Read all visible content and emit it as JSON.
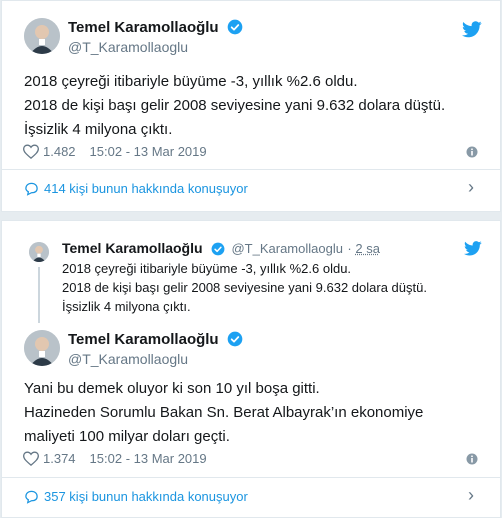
{
  "tweet1": {
    "name": "Temel Karamollaoğlu",
    "handle": "@T_Karamollaoglu",
    "lines": [
      "2018 çeyreği itibariyle büyüme -3, yıllık %2.6 oldu.",
      "2018 de kişi başı gelir 2008 seviyesine yani 9.632 dolara düştü.",
      "İşsizlik 4 milyona çıktı."
    ],
    "likes": "1.482",
    "timestamp": "15:02 - 13 Mar 2019",
    "talking": "414 kişi bunun hakkında konuşuyor"
  },
  "tweet2": {
    "quoted": {
      "name": "Temel Karamollaoğlu",
      "handle": "@T_Karamollaoglu",
      "time": "2 sa",
      "lines": [
        "2018 çeyreği itibariyle büyüme -3, yıllık %2.6 oldu.",
        "2018 de kişi başı gelir 2008 seviyesine yani 9.632 dolara düştü.",
        "İşsizlik 4 milyona çıktı."
      ]
    },
    "name": "Temel Karamollaoğlu",
    "handle": "@T_Karamollaoglu",
    "lines": [
      "Yani bu demek oluyor ki son 10 yıl boşa gitti.",
      "Hazineden Sorumlu Bakan Sn. Berat Albayrak’ın ekonomiye",
      "maliyeti 100 milyar doları geçti."
    ],
    "likes": "1.374",
    "timestamp": "15:02 - 13 Mar 2019",
    "talking": "357 kişi bunun hakkında konuşuyor"
  },
  "colors": {
    "accent": "#1da1f2",
    "link": "#1b95e0",
    "muted": "#657786",
    "like_outline": "#657786"
  },
  "icons": [
    "twitter-bird-icon",
    "verified-badge-icon",
    "heart-icon",
    "info-icon",
    "chat-bubble-icon",
    "chevron-right-icon"
  ]
}
